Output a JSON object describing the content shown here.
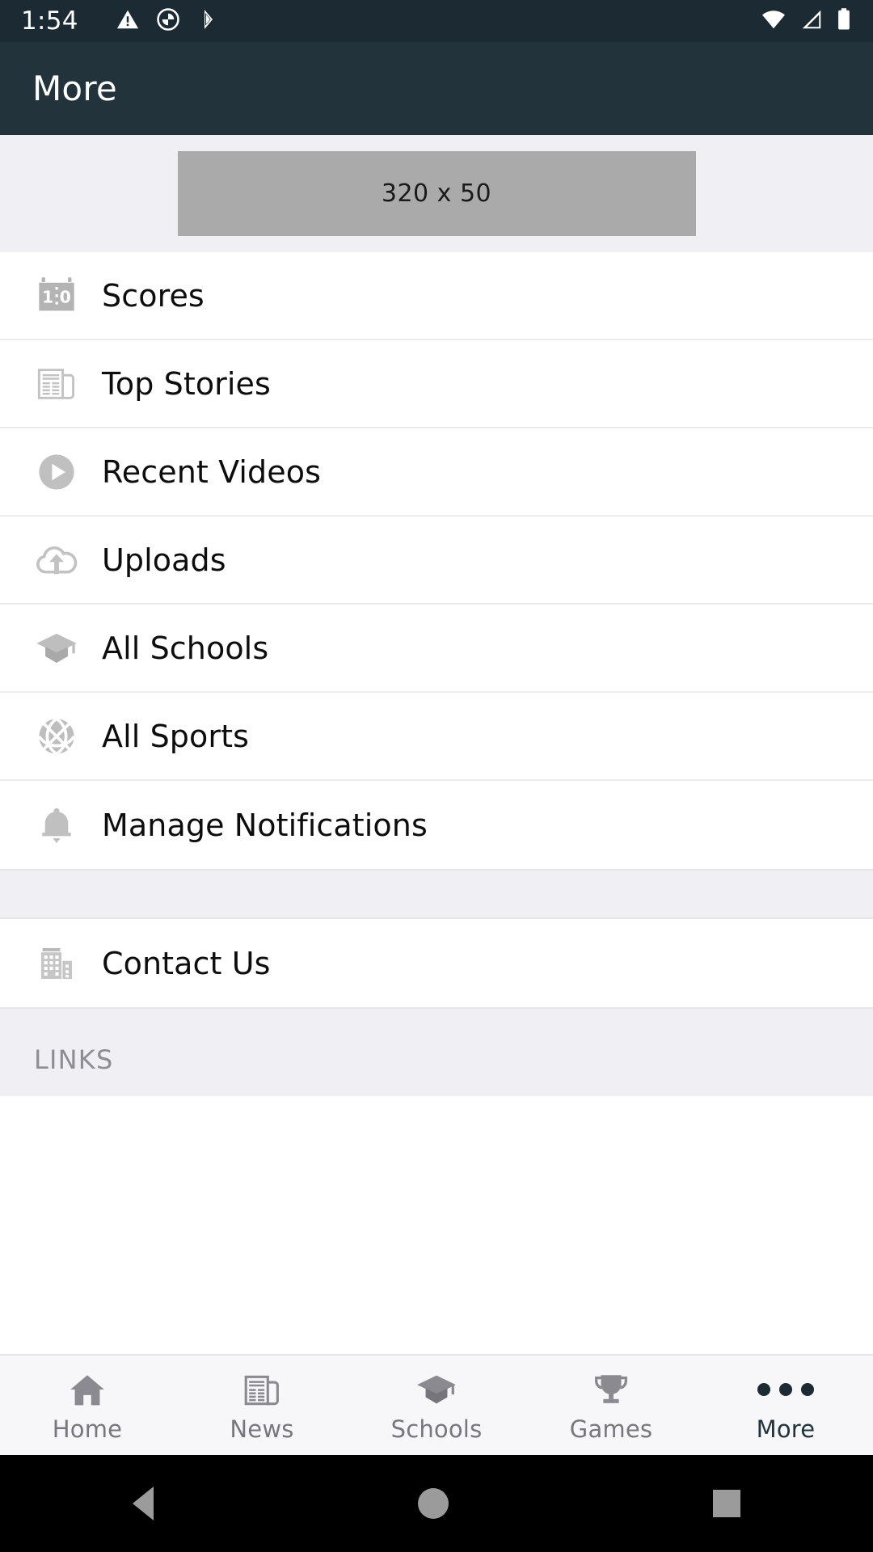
{
  "status_bar": {
    "time": "1:54",
    "left_icons": [
      "warning-triangle-icon",
      "do-not-disturb-icon",
      "bluetooth-share-icon"
    ],
    "right_icons": [
      "wifi-icon",
      "cellular-signal-icon",
      "battery-icon"
    ],
    "background": "#1c2b33"
  },
  "app_bar": {
    "title": "More",
    "background": "#22333b",
    "text_color": "#ffffff"
  },
  "ad": {
    "label": "320 x 50",
    "background": "#aaaaaa"
  },
  "menu": {
    "items": [
      {
        "label": "Scores",
        "icon": "scoreboard-icon",
        "score_left": "1",
        "score_right": "0"
      },
      {
        "label": "Top Stories",
        "icon": "newspaper-icon"
      },
      {
        "label": "Recent Videos",
        "icon": "play-circle-icon"
      },
      {
        "label": "Uploads",
        "icon": "cloud-upload-icon"
      },
      {
        "label": "All Schools",
        "icon": "graduation-cap-icon"
      },
      {
        "label": "All Sports",
        "icon": "basketball-icon"
      },
      {
        "label": "Manage Notifications",
        "icon": "bell-icon"
      }
    ],
    "secondary_items": [
      {
        "label": "Contact Us",
        "icon": "building-icon"
      }
    ]
  },
  "links_section": {
    "title": "LINKS"
  },
  "bottom_nav": {
    "items": [
      {
        "label": "Home",
        "icon": "home-icon",
        "active": false
      },
      {
        "label": "News",
        "icon": "newspaper-icon",
        "active": false
      },
      {
        "label": "Schools",
        "icon": "graduation-cap-icon",
        "active": false
      },
      {
        "label": "Games",
        "icon": "trophy-icon",
        "active": false
      },
      {
        "label": "More",
        "icon": "ellipsis-icon",
        "active": true
      }
    ],
    "active_color": "#22333b",
    "inactive_color": "#77777d"
  },
  "system_nav": {
    "buttons": [
      "back-button",
      "home-button",
      "recents-button"
    ]
  }
}
